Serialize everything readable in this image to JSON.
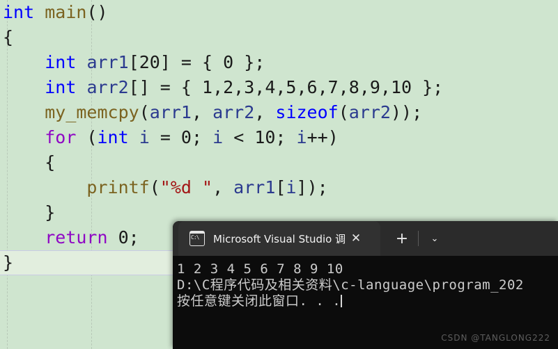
{
  "editor": {
    "background_color": "#cfe5cf",
    "current_line_color": "#e2eede",
    "lines": [
      {
        "indent": 0,
        "tokens": [
          {
            "t": "int",
            "c": "kw"
          },
          {
            "t": " ",
            "c": "pun"
          },
          {
            "t": "main",
            "c": "fn"
          },
          {
            "t": "()",
            "c": "pun"
          }
        ]
      },
      {
        "indent": 0,
        "tokens": [
          {
            "t": "{",
            "c": "pun"
          }
        ]
      },
      {
        "indent": 1,
        "tokens": [
          {
            "t": "int",
            "c": "kw"
          },
          {
            "t": " ",
            "c": "pun"
          },
          {
            "t": "arr1",
            "c": "id"
          },
          {
            "t": "[",
            "c": "pun"
          },
          {
            "t": "20",
            "c": "num"
          },
          {
            "t": "] = { ",
            "c": "pun"
          },
          {
            "t": "0",
            "c": "num"
          },
          {
            "t": " };",
            "c": "pun"
          }
        ]
      },
      {
        "indent": 1,
        "tokens": [
          {
            "t": "int",
            "c": "kw"
          },
          {
            "t": " ",
            "c": "pun"
          },
          {
            "t": "arr2",
            "c": "id"
          },
          {
            "t": "[] = { ",
            "c": "pun"
          },
          {
            "t": "1,2,3,4,5,6,7,8,9,10",
            "c": "num"
          },
          {
            "t": " };",
            "c": "pun"
          }
        ]
      },
      {
        "indent": 1,
        "tokens": [
          {
            "t": "my_memcpy",
            "c": "fn"
          },
          {
            "t": "(",
            "c": "pun"
          },
          {
            "t": "arr1",
            "c": "id"
          },
          {
            "t": ", ",
            "c": "pun"
          },
          {
            "t": "arr2",
            "c": "id"
          },
          {
            "t": ", ",
            "c": "pun"
          },
          {
            "t": "sizeof",
            "c": "kw"
          },
          {
            "t": "(",
            "c": "pun"
          },
          {
            "t": "arr2",
            "c": "id"
          },
          {
            "t": "));",
            "c": "pun"
          }
        ]
      },
      {
        "indent": 1,
        "tokens": [
          {
            "t": "for",
            "c": "kw2"
          },
          {
            "t": " (",
            "c": "pun"
          },
          {
            "t": "int",
            "c": "kw"
          },
          {
            "t": " ",
            "c": "pun"
          },
          {
            "t": "i",
            "c": "id"
          },
          {
            "t": " = ",
            "c": "pun"
          },
          {
            "t": "0",
            "c": "num"
          },
          {
            "t": "; ",
            "c": "pun"
          },
          {
            "t": "i",
            "c": "id"
          },
          {
            "t": " < ",
            "c": "pun"
          },
          {
            "t": "10",
            "c": "num"
          },
          {
            "t": "; ",
            "c": "pun"
          },
          {
            "t": "i",
            "c": "id"
          },
          {
            "t": "++)",
            "c": "pun"
          }
        ]
      },
      {
        "indent": 1,
        "tokens": [
          {
            "t": "{",
            "c": "pun"
          }
        ]
      },
      {
        "indent": 2,
        "tokens": [
          {
            "t": "printf",
            "c": "fn"
          },
          {
            "t": "(",
            "c": "pun"
          },
          {
            "t": "\"%d \"",
            "c": "str"
          },
          {
            "t": ", ",
            "c": "pun"
          },
          {
            "t": "arr1",
            "c": "id"
          },
          {
            "t": "[",
            "c": "pun"
          },
          {
            "t": "i",
            "c": "id"
          },
          {
            "t": "]);",
            "c": "pun"
          }
        ]
      },
      {
        "indent": 1,
        "tokens": [
          {
            "t": "}",
            "c": "pun"
          }
        ]
      },
      {
        "indent": 1,
        "tokens": [
          {
            "t": "return",
            "c": "kw2"
          },
          {
            "t": " ",
            "c": "pun"
          },
          {
            "t": "0",
            "c": "num"
          },
          {
            "t": ";",
            "c": "pun"
          }
        ]
      },
      {
        "indent": 0,
        "current": true,
        "tokens": [
          {
            "t": "}",
            "c": "pun"
          }
        ]
      }
    ]
  },
  "console": {
    "tab": {
      "icon": "command-prompt-icon",
      "title": "Microsoft Visual Studio 调试控",
      "close_label": "✕"
    },
    "toolbar": {
      "new_tab_label": "+",
      "dropdown_label": "⌄"
    },
    "output": [
      "1 2 3 4 5 6 7 8 9 10",
      "D:\\C程序代码及相关资料\\c-language\\program_202",
      "按任意键关闭此窗口. . ."
    ]
  },
  "watermark": {
    "text": "CSDN @TANGLONG222"
  }
}
